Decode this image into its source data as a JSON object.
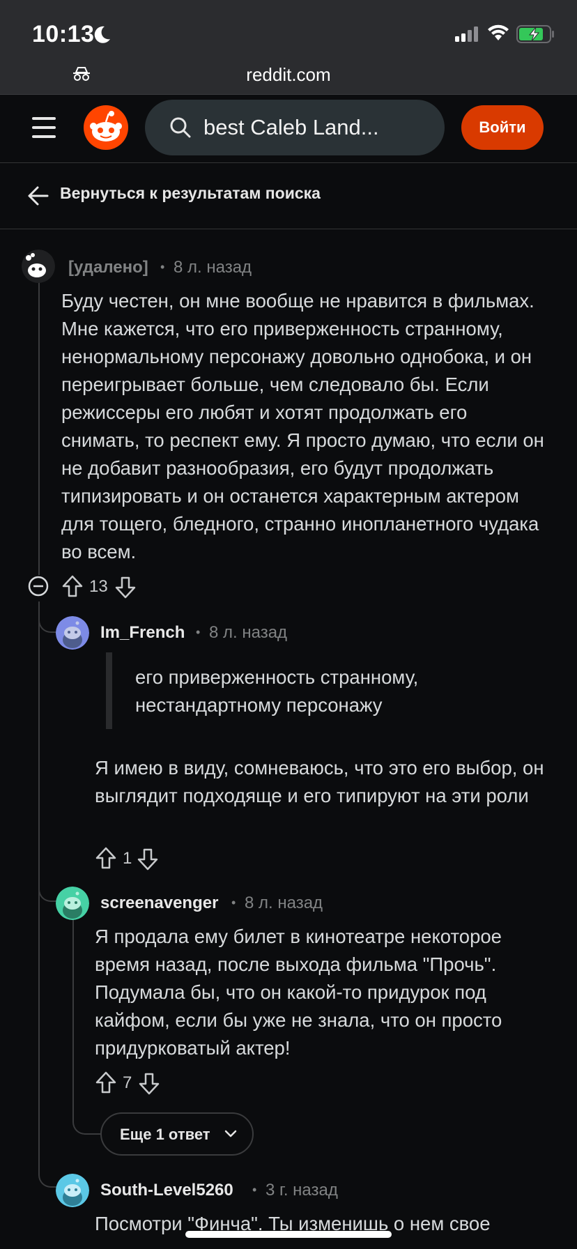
{
  "status_bar": {
    "time": "10:13"
  },
  "browser": {
    "url": "reddit.com"
  },
  "header": {
    "search_text": "best Caleb Land...",
    "login_label": "Войти"
  },
  "back_link": "Вернуться к результатам поиска",
  "comments": [
    {
      "author": "[удалено]",
      "age": "8 л. назад",
      "body": "Буду честен, он мне вообще не нравится в фильмах. Мне кажется, что его приверженность странному, ненормальному персонажу довольно однобока, и он переигрывает больше, чем следовало бы. Если режиссеры его любят и хотят продолжать его снимать, то респект ему. Я просто думаю, что если он не добавит разнообразия, его будут продолжать типизировать и он останется характерным актером для тощего, бледного, странно инопланетного чудака во всем.",
      "score": "13"
    },
    {
      "author": "Im_French",
      "age": "8 л. назад",
      "quote": "его приверженность странному, нестандартному персонажу",
      "body": "Я имею в виду, сомневаюсь, что это его выбор, он выглядит подходяще и его типируют на эти роли",
      "score": "1"
    },
    {
      "author": "screenavenger",
      "age": "8 л. назад",
      "body": "Я продала ему билет в кинотеатре некоторое время назад, после выхода фильма \"Прочь\". Подумала бы, что он какой-то придурок под кайфом, если бы уже не знала, что он просто придурковатый актер!",
      "score": "7",
      "more_replies": "Еще 1 ответ"
    },
    {
      "author": "South-Level5260",
      "age": "3 г. назад",
      "body": "Посмотри \"Финча\". Ты изменишь о нем свое"
    }
  ],
  "colors": {
    "accent": "#d93a00",
    "reddit_orange": "#ff4500",
    "background": "#0b0c0e",
    "text": "#d7dadc",
    "muted": "#818384"
  }
}
